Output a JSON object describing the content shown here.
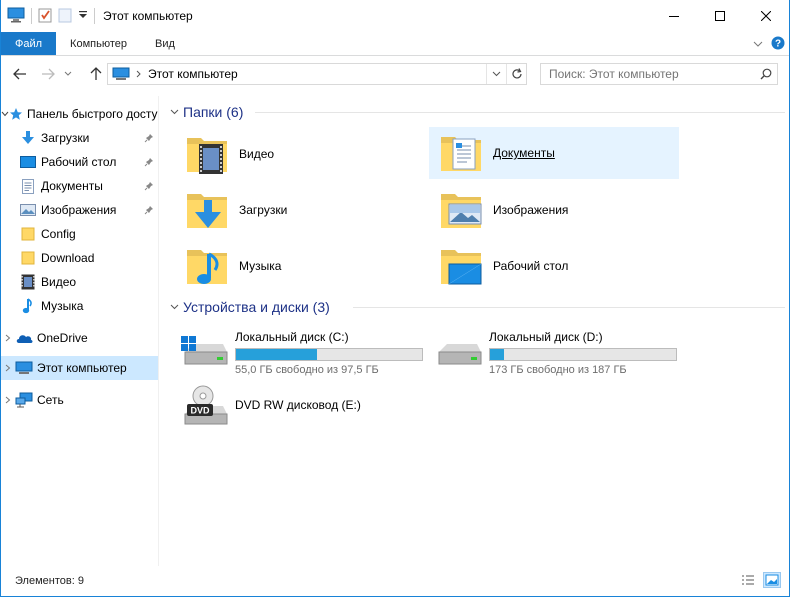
{
  "window": {
    "title": "Этот компьютер"
  },
  "ribbon": {
    "tabs": [
      "Файл",
      "Компьютер",
      "Вид"
    ]
  },
  "address": {
    "crumb": "Этот компьютер"
  },
  "search": {
    "placeholder": "Поиск: Этот компьютер"
  },
  "nav": {
    "items": [
      {
        "label": "Панель быстрого доступа",
        "icon": "star-icon"
      },
      {
        "label": "Загрузки",
        "icon": "download-icon",
        "pinned": true
      },
      {
        "label": "Рабочий стол",
        "icon": "desktop-icon",
        "pinned": true
      },
      {
        "label": "Документы",
        "icon": "document-icon",
        "pinned": true
      },
      {
        "label": "Изображения",
        "icon": "pictures-icon",
        "pinned": true
      },
      {
        "label": "Config",
        "icon": "folder-icon"
      },
      {
        "label": "Download",
        "icon": "folder-icon"
      },
      {
        "label": "Видео",
        "icon": "video-icon"
      },
      {
        "label": "Музыка",
        "icon": "music-icon"
      },
      {
        "label": "OneDrive",
        "icon": "cloud-icon"
      },
      {
        "label": "Этот компьютер",
        "icon": "computer-icon",
        "selected": true
      },
      {
        "label": "Сеть",
        "icon": "network-icon"
      }
    ]
  },
  "content": {
    "folders_header": "Папки (6)",
    "folders": [
      {
        "label": "Видео",
        "icon": "video-folder-icon"
      },
      {
        "label": "Документы",
        "icon": "documents-folder-icon",
        "hover": true
      },
      {
        "label": "Загрузки",
        "icon": "downloads-folder-icon"
      },
      {
        "label": "Изображения",
        "icon": "pictures-folder-icon"
      },
      {
        "label": "Музыка",
        "icon": "music-folder-icon"
      },
      {
        "label": "Рабочий стол",
        "icon": "desktop-folder-icon"
      }
    ],
    "drives_header": "Устройства и диски (3)",
    "drives": [
      {
        "label": "Локальный диск (C:)",
        "free": "55,0 ГБ свободно из 97,5 ГБ",
        "used_fraction": 0.436
      },
      {
        "label": "Локальный диск (D:)",
        "free": "173 ГБ свободно из 187 ГБ",
        "used_fraction": 0.075
      },
      {
        "label": "DVD RW дисковод (E:)"
      }
    ]
  },
  "status": {
    "count": "Элементов: 9"
  },
  "colors": {
    "accent": "#1979ca",
    "selected": "#cce8ff",
    "hover": "#e5f3ff",
    "bar_fill": "#26a0da",
    "header": "#1e3287"
  }
}
